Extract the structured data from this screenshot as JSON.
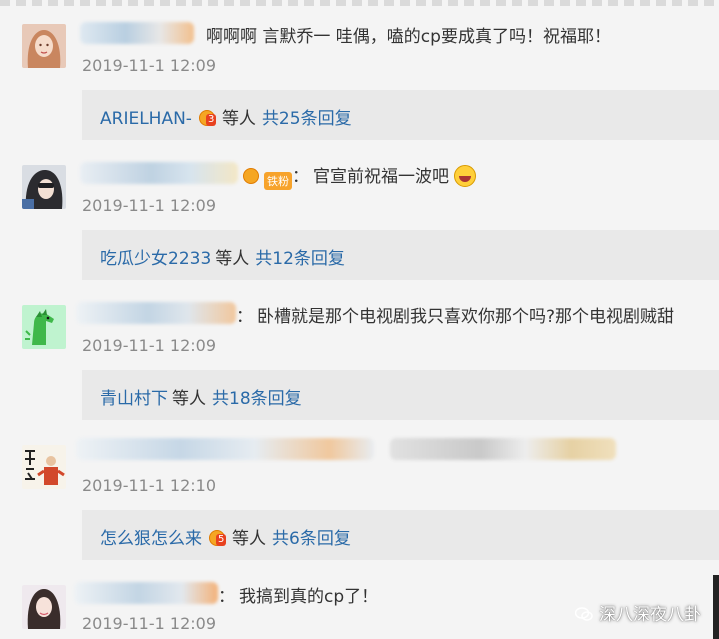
{
  "comments": [
    {
      "text": "啊啊啊 言默乔一 哇偶，嗑的cp要成真了吗！祝福耶！",
      "time": "2019-11-1 12:09",
      "reply": {
        "user": "ARIELHAN-",
        "badge": "3",
        "deng": "等人",
        "count": "共25条回复"
      }
    },
    {
      "fan": "铁粉",
      "text": "官宣前祝福一波吧",
      "time": "2019-11-1 12:09",
      "reply": {
        "user": "吃瓜少女2233",
        "deng": "等人",
        "count": "共12条回复"
      }
    },
    {
      "text": "卧槽就是那个电视剧我只喜欢你那个吗?那个电视剧贼甜",
      "time": "2019-11-1 12:09",
      "reply": {
        "user": "青山村下",
        "deng": "等人",
        "count": "共18条回复"
      }
    },
    {
      "time": "2019-11-1 12:10",
      "reply": {
        "user": "怎么狠怎么来",
        "badge": "5",
        "deng": "等人",
        "count": "共6条回复"
      }
    },
    {
      "text": "我搞到真的cp了！",
      "time": "2019-11-1 12:09"
    }
  ],
  "colon": "：",
  "watermark": "深八深夜八卦",
  "colors": {
    "link": "#2a6aa8",
    "time": "#8a8a8a",
    "reply_bg": "#e9e9e9",
    "page_bg": "#f4f4f4"
  }
}
